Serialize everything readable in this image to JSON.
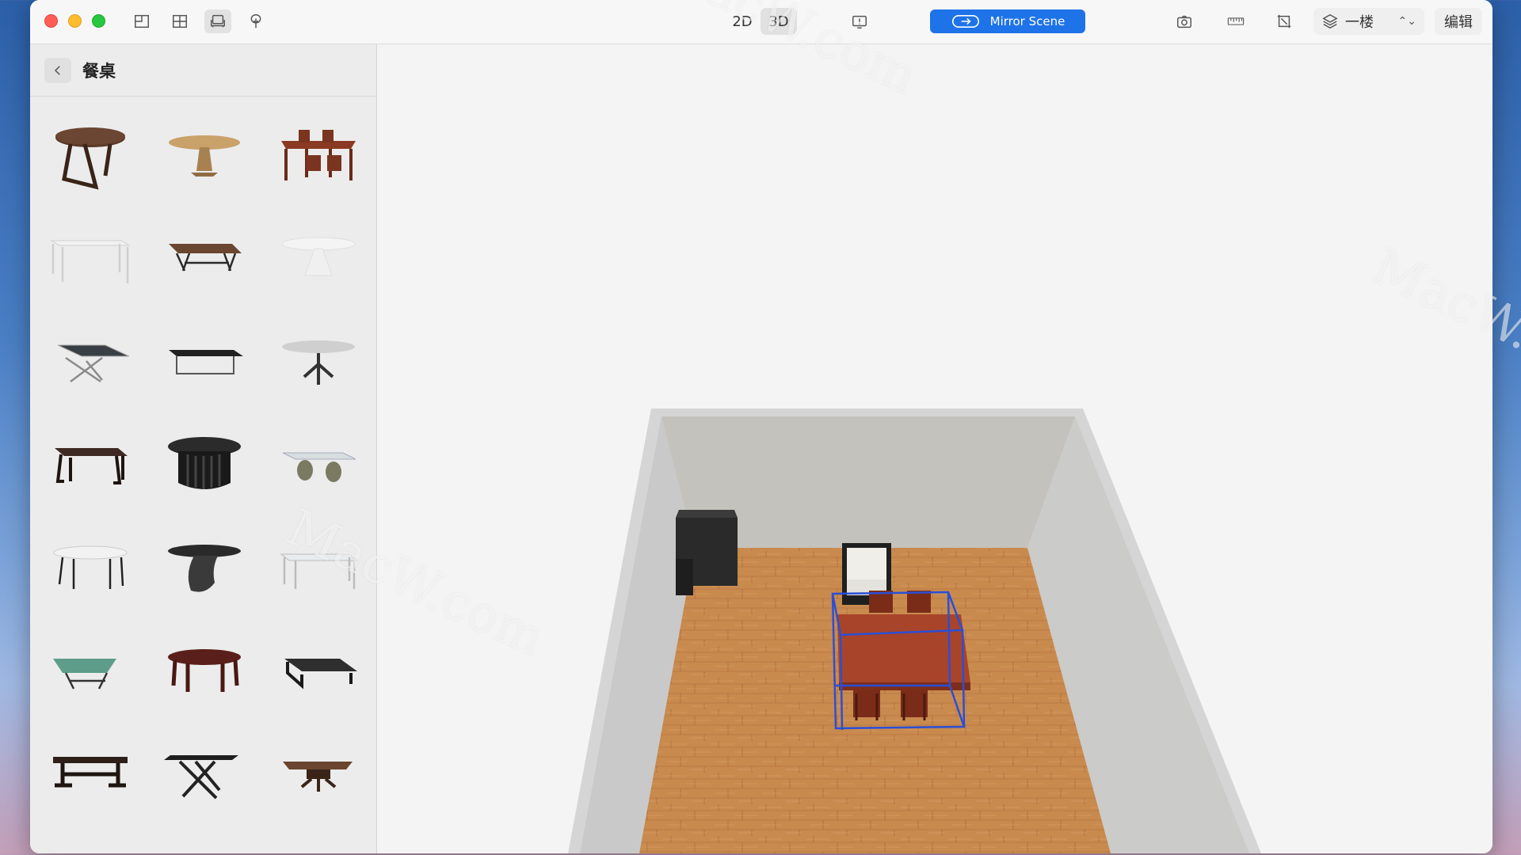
{
  "toolbar": {
    "view_2d": "2D",
    "view_3d": "3D",
    "mirror_label": "Mirror Scene",
    "floor_value": "一楼",
    "edit_label": "编辑"
  },
  "sidebar": {
    "title": "餐桌",
    "items": [
      {
        "name": "dark-round-table-crossed-legs"
      },
      {
        "name": "light-round-pedestal-table"
      },
      {
        "name": "table-with-chairs-set"
      },
      {
        "name": "white-rectangular-table"
      },
      {
        "name": "wooden-trestle-table"
      },
      {
        "name": "white-oval-pedestal-table"
      },
      {
        "name": "black-glass-x-leg-table"
      },
      {
        "name": "black-slab-table"
      },
      {
        "name": "grey-round-spider-table"
      },
      {
        "name": "dark-wood-table"
      },
      {
        "name": "dark-round-slat-base-table"
      },
      {
        "name": "glass-top-double-base-table"
      },
      {
        "name": "white-oval-four-leg-table"
      },
      {
        "name": "black-sculptural-pedestal-table"
      },
      {
        "name": "glass-rectangular-table"
      },
      {
        "name": "green-glass-table"
      },
      {
        "name": "red-oval-table"
      },
      {
        "name": "black-low-table"
      },
      {
        "name": "dark-trestle-table"
      },
      {
        "name": "black-x-base-table"
      },
      {
        "name": "brown-wood-pedestal-table"
      }
    ]
  },
  "watermark": "MacW.com",
  "colors": {
    "accent": "#1e73e8",
    "selection": "#2a4fd6",
    "floor_wood": "#c98a4e"
  }
}
